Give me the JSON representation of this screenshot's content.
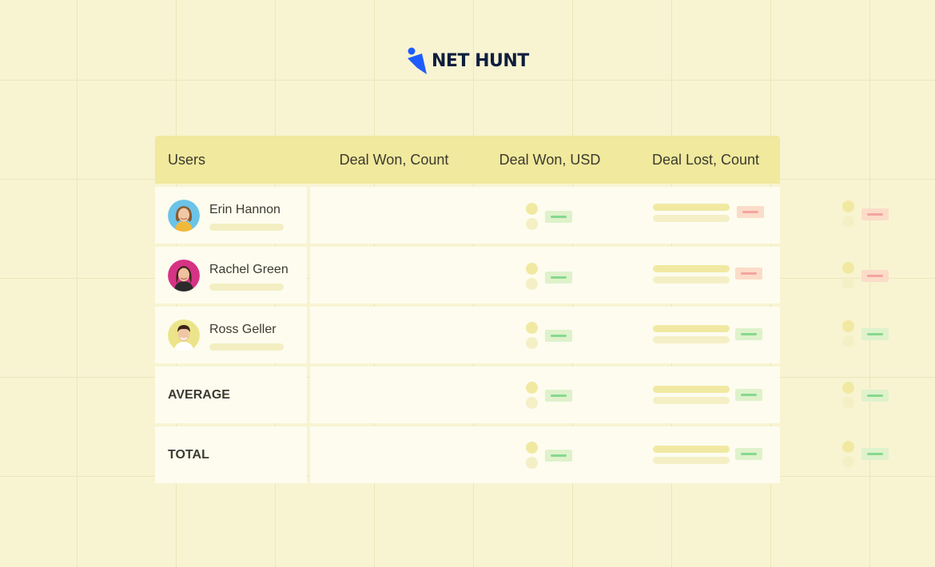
{
  "brand": {
    "name": "NetHunt",
    "logo_text": "NET HUNT",
    "color": "#1f5cff"
  },
  "table": {
    "headers": {
      "users": "Users",
      "deal_won_count": "Deal Won, Count",
      "deal_won_usd": "Deal Won, USD",
      "deal_lost_count": "Deal Lost, Count"
    },
    "rows": [
      {
        "name": "Erin Hannon",
        "avatar": "avatar-erin",
        "won_count_status": "green",
        "won_usd_status": "red",
        "lost_count_status": "red"
      },
      {
        "name": "Rachel Green",
        "avatar": "avatar-rachel",
        "won_count_status": "green",
        "won_usd_status": "red",
        "lost_count_status": "red"
      },
      {
        "name": "Ross Geller",
        "avatar": "avatar-ross",
        "won_count_status": "green",
        "won_usd_status": "green",
        "lost_count_status": "green"
      }
    ],
    "summary": [
      {
        "label": "AVERAGE"
      },
      {
        "label": "TOTAL"
      }
    ]
  },
  "colors": {
    "background": "#f8f4d2",
    "header": "#f0e99e",
    "row": "#fdfcef",
    "positive": "#86d98f",
    "negative": "#f4a4a0"
  }
}
